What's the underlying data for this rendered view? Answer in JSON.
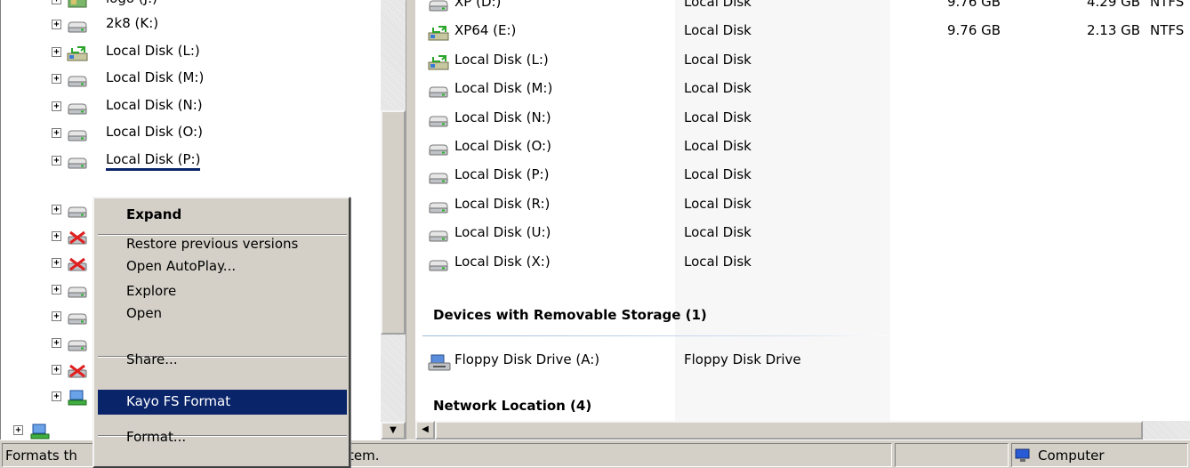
{
  "tree": {
    "top_partial_label": "logo (J:)",
    "items": [
      {
        "label": "2k8 (K:)",
        "icon": "hard-drive"
      },
      {
        "label": "Local Disk (L:)",
        "icon": "network-drive"
      },
      {
        "label": "Local Disk (M:)",
        "icon": "hard-drive"
      },
      {
        "label": "Local Disk (N:)",
        "icon": "hard-drive"
      },
      {
        "label": "Local Disk (O:)",
        "icon": "hard-drive"
      },
      {
        "label": "Local Disk (P:)",
        "icon": "hard-drive"
      }
    ],
    "hidden_row_icons": [
      "hard-drive",
      "disconnected-drive",
      "disconnected-drive",
      "hard-drive",
      "hard-drive",
      "hard-drive",
      "disconnected-drive",
      "network-location"
    ]
  },
  "list": {
    "drives": [
      {
        "name": "XP (D:)",
        "type": "Local Disk",
        "total": "9.76 GB",
        "free": "4.29 GB",
        "fs": "NTFS",
        "icon": "hard-drive"
      },
      {
        "name": "XP64 (E:)",
        "type": "Local Disk",
        "total": "9.76 GB",
        "free": "2.13 GB",
        "fs": "NTFS",
        "icon": "network-drive"
      },
      {
        "name": "Local Disk (L:)",
        "type": "Local Disk",
        "icon": "network-drive"
      },
      {
        "name": "Local Disk (M:)",
        "type": "Local Disk",
        "icon": "hard-drive"
      },
      {
        "name": "Local Disk (N:)",
        "type": "Local Disk",
        "icon": "hard-drive"
      },
      {
        "name": "Local Disk (O:)",
        "type": "Local Disk",
        "icon": "hard-drive"
      },
      {
        "name": "Local Disk (P:)",
        "type": "Local Disk",
        "icon": "hard-drive"
      },
      {
        "name": "Local Disk (R:)",
        "type": "Local Disk",
        "icon": "hard-drive"
      },
      {
        "name": "Local Disk (U:)",
        "type": "Local Disk",
        "icon": "hard-drive"
      },
      {
        "name": "Local Disk (X:)",
        "type": "Local Disk",
        "icon": "hard-drive"
      }
    ],
    "removable_header": "Devices with Removable Storage (1)",
    "removable": [
      {
        "name": "Floppy Disk Drive (A:)",
        "type": "Floppy Disk Drive",
        "icon": "floppy-drive"
      }
    ],
    "network_header": "Network Location (4)"
  },
  "context_menu": {
    "items": [
      {
        "label": "Expand",
        "bold": true
      },
      {
        "separator": true
      },
      {
        "label": "Restore previous versions"
      },
      {
        "label": "Open AutoPlay..."
      },
      {
        "label": "Explore"
      },
      {
        "label": "Open"
      },
      {
        "separator": true
      },
      {
        "label": "Share..."
      },
      {
        "separator": true
      },
      {
        "label": "Kayo FS Format",
        "highlighted": true
      },
      {
        "separator": true
      },
      {
        "label": "Format..."
      }
    ]
  },
  "status_bar": {
    "left_text_start": "Formats th",
    "left_text_end": "tem.",
    "location": "Computer"
  },
  "colors": {
    "highlight": "#0a246a",
    "menu_bg": "#d4d0c8",
    "group_line": "#9dbbd8"
  }
}
